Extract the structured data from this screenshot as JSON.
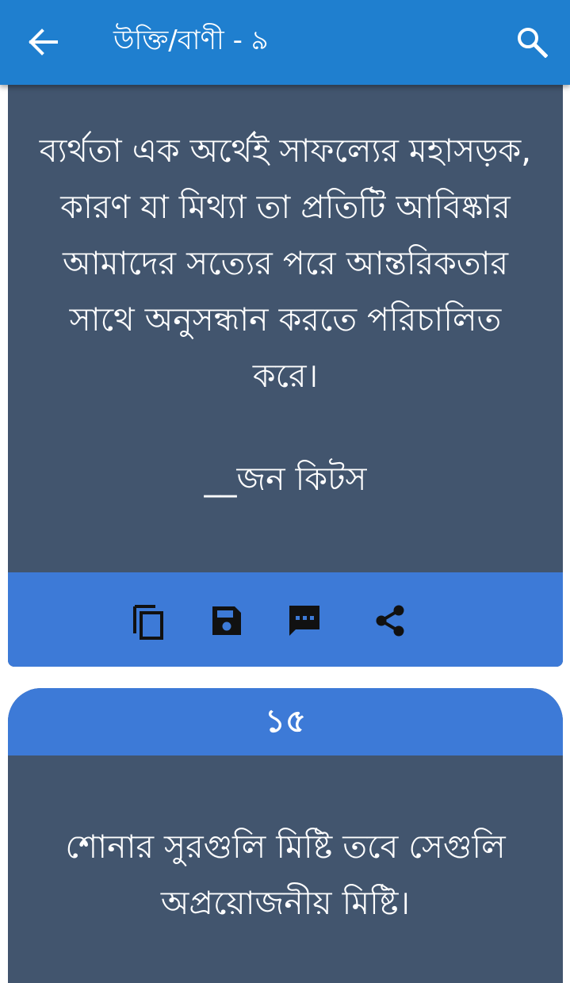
{
  "appbar": {
    "title": "উক্তি/বাণী - ৯",
    "back_icon": "arrow-back-icon",
    "search_icon": "search-icon"
  },
  "colors": {
    "appbar": "#1f7fcf",
    "card_body": "#42556e",
    "card_accent": "#3d7ad7",
    "text": "#ffffff"
  },
  "cards": [
    {
      "quote_lines": [
        "ব্যর্থতা এক অর্থেই সাফল্যের মহাসড়ক,",
        "কারণ যা মিথ্যা তা প্রতিটি আবিষ্কার",
        "আমাদের সত্যের পরে আন্তরিকতার",
        "সাথে অনুসন্ধান করতে পরিচালিত",
        "করে।"
      ],
      "author": "__জন কিটস",
      "actions": [
        "copy-icon",
        "save-icon",
        "message-icon",
        "share-icon"
      ]
    },
    {
      "number": "১৫",
      "quote_lines": [
        "শোনার সুরগুলি মিষ্টি তবে সেগুলি",
        "অপ্রয়োজনীয় মিষ্টি।"
      ]
    }
  ]
}
